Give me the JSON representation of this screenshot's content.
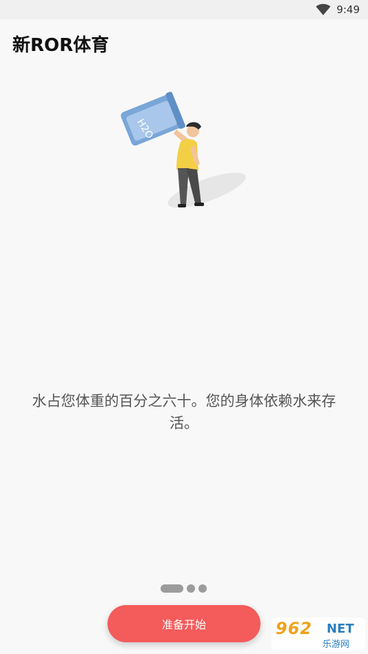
{
  "status_bar": {
    "time": "9:49",
    "wifi_icon": "wifi-icon"
  },
  "app": {
    "title": "新ROR体育"
  },
  "illustration": {
    "icon": "person-drinking-water-illustration",
    "cup_text": "H2O"
  },
  "onboarding": {
    "message": "水占您体重的百分之六十。您的身体依赖水来存活。",
    "page_count": 3,
    "current_page": 1
  },
  "actions": {
    "start_label": "准备开始"
  },
  "watermark": {
    "brand": "962",
    "suffix": "NET",
    "subtitle": "乐游网"
  },
  "colors": {
    "accent": "#f45b5b",
    "indicator": "#9c9c9c",
    "background": "#f8f8f8"
  }
}
